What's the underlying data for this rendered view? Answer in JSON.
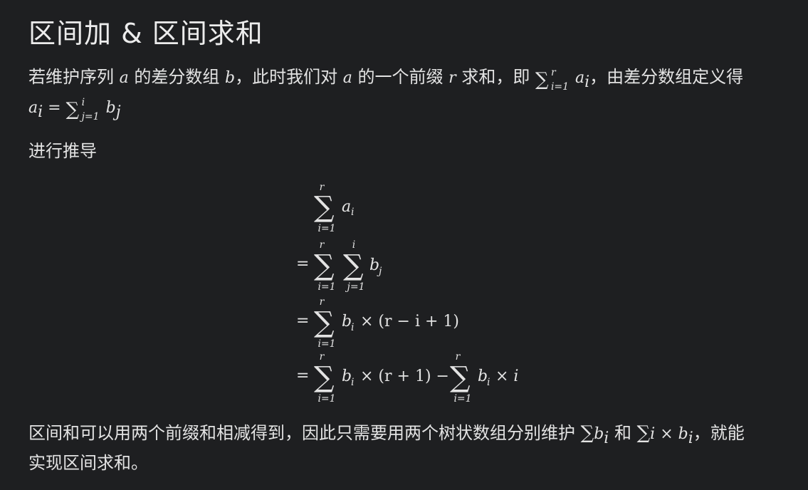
{
  "title": "区间加 & 区间求和",
  "paragraph1": {
    "t1": "若维护序列 ",
    "v_a": "a",
    "t2": " 的差分数组 ",
    "v_b": "b",
    "t3": "，此时我们对 ",
    "v_a2": "a",
    "t4": " 的一个前缀 ",
    "v_r": "r",
    "t5": " 求和，即 ",
    "sum_sup": "r",
    "sum_sub": "i=1",
    "sum_term": "a",
    "sum_term_sub": "i",
    "t6": "，由差分数组定义得",
    "line2_lhs": "a",
    "line2_lhs_sub": "i",
    "line2_eq": " = ",
    "line2_sum_sup": "i",
    "line2_sum_sub": "j=1",
    "line2_term": "b",
    "line2_term_sub": "j"
  },
  "paragraph2": "进行推导",
  "derivation": {
    "sum_symbol": "∑",
    "eq": "=",
    "row1": {
      "upper": "r",
      "lower": "i=1",
      "term": "a",
      "term_sub": "i"
    },
    "row2": {
      "upper1": "r",
      "lower1": "i=1",
      "upper2": "i",
      "lower2": "j=1",
      "term": "b",
      "term_sub": "j"
    },
    "row3": {
      "upper": "r",
      "lower": "i=1",
      "term": "b",
      "term_sub": "i",
      "rest": "× (r − i + 1)"
    },
    "row4": {
      "upper1": "r",
      "lower1": "i=1",
      "term1": "b",
      "term1_sub": "i",
      "mid": "× (r + 1) −",
      "upper2": "r",
      "lower2": "i=1",
      "term2": "b",
      "term2_sub": "i",
      "tail": "× i"
    }
  },
  "paragraph3": {
    "t1": "区间和可以用两个前缀和相减得到，因此只需要用两个树状数组分别维护 ",
    "sum1": "∑",
    "sum1_term": "b",
    "sum1_term_sub": "i",
    "t2": " 和 ",
    "sum2": "∑",
    "sum2_term": "i × b",
    "sum2_term_sub": "i",
    "t3": "，就能",
    "line2": "实现区间求和。"
  }
}
